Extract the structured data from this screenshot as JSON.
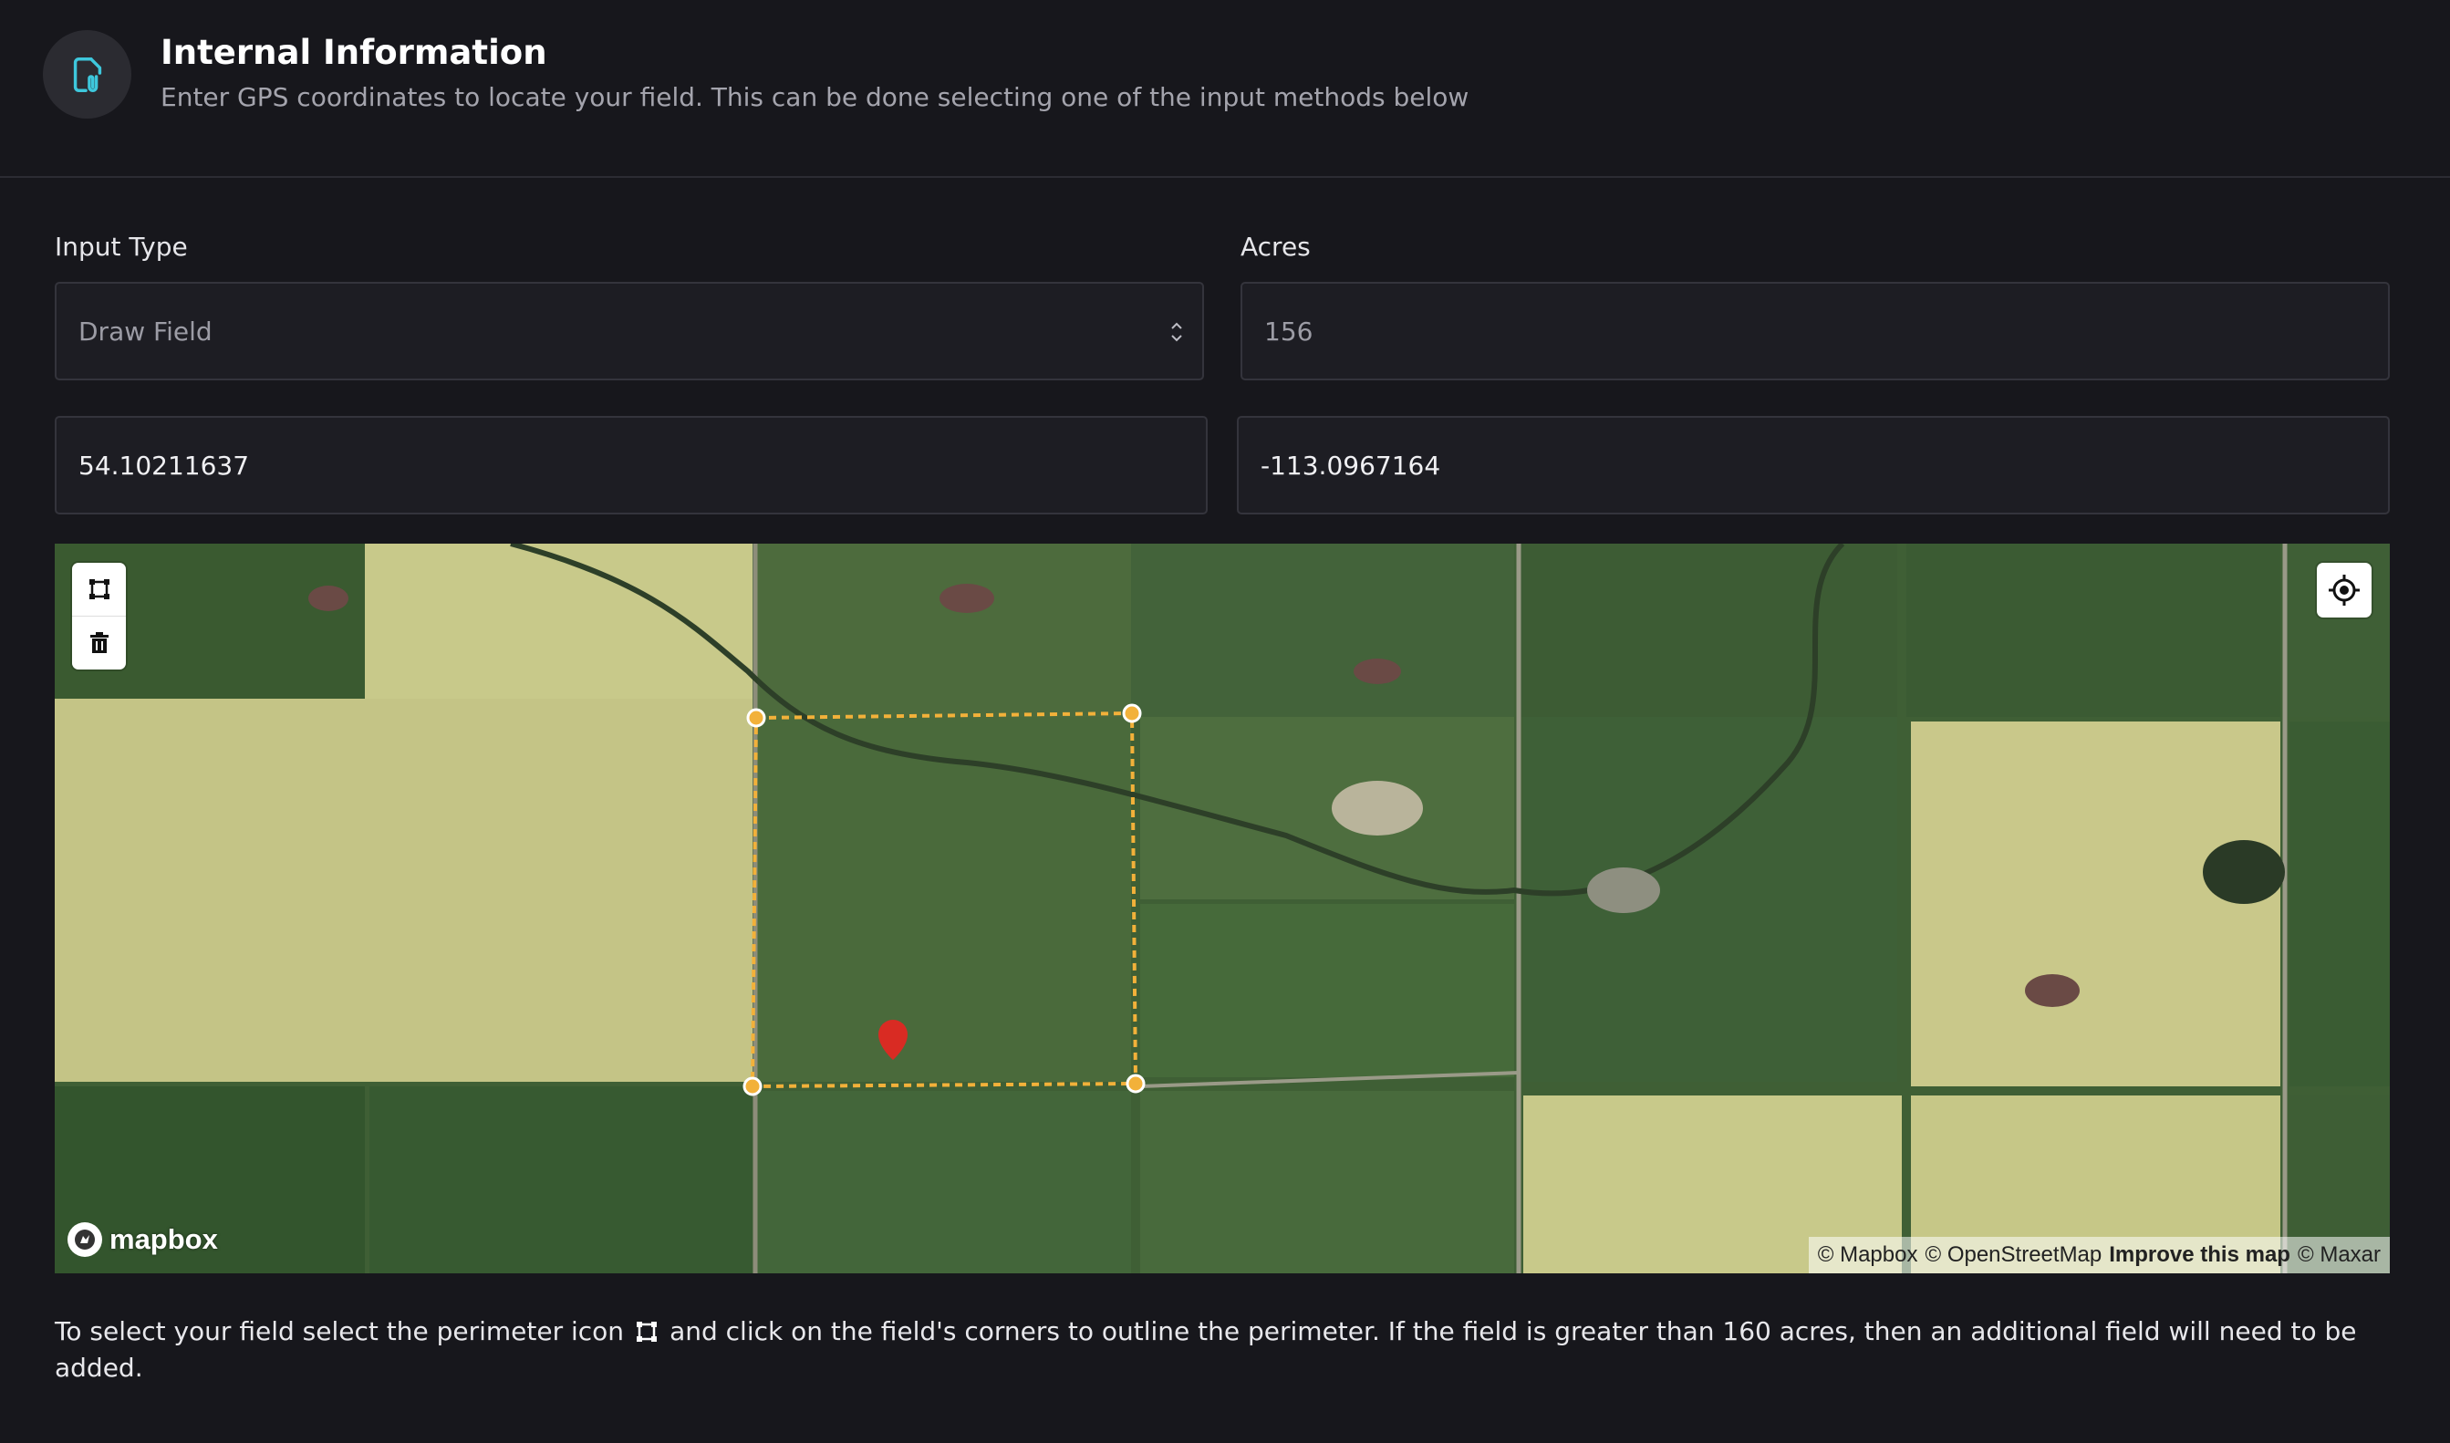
{
  "header": {
    "title": "Internal Information",
    "subtitle": "Enter GPS coordinates to locate your field. This can be done selecting one of the input methods below",
    "icon": "document-clip-icon"
  },
  "form": {
    "input_type_label": "Input Type",
    "input_type_value": "Draw Field",
    "acres_label": "Acres",
    "acres_value": "156",
    "latitude_value": "54.10211637",
    "longitude_value": "-113.0967164"
  },
  "map": {
    "tools": [
      "polygon-draw-icon",
      "trash-icon"
    ],
    "geolocate_icon": "geolocate-icon",
    "logo_text": "mapbox",
    "attribution": {
      "mapbox": "© Mapbox",
      "osm": "© OpenStreetMap",
      "improve": "Improve this map",
      "maxar": "© Maxar"
    },
    "colors": {
      "perimeter": "#f2b13a",
      "marker": "#d92b23"
    }
  },
  "footnote": {
    "before_icon": "To select your field select the perimeter icon",
    "after_icon": "and click on the field's corners to outline the perimeter. If the field is greater than 160 acres, then an additional field will need to be added."
  }
}
